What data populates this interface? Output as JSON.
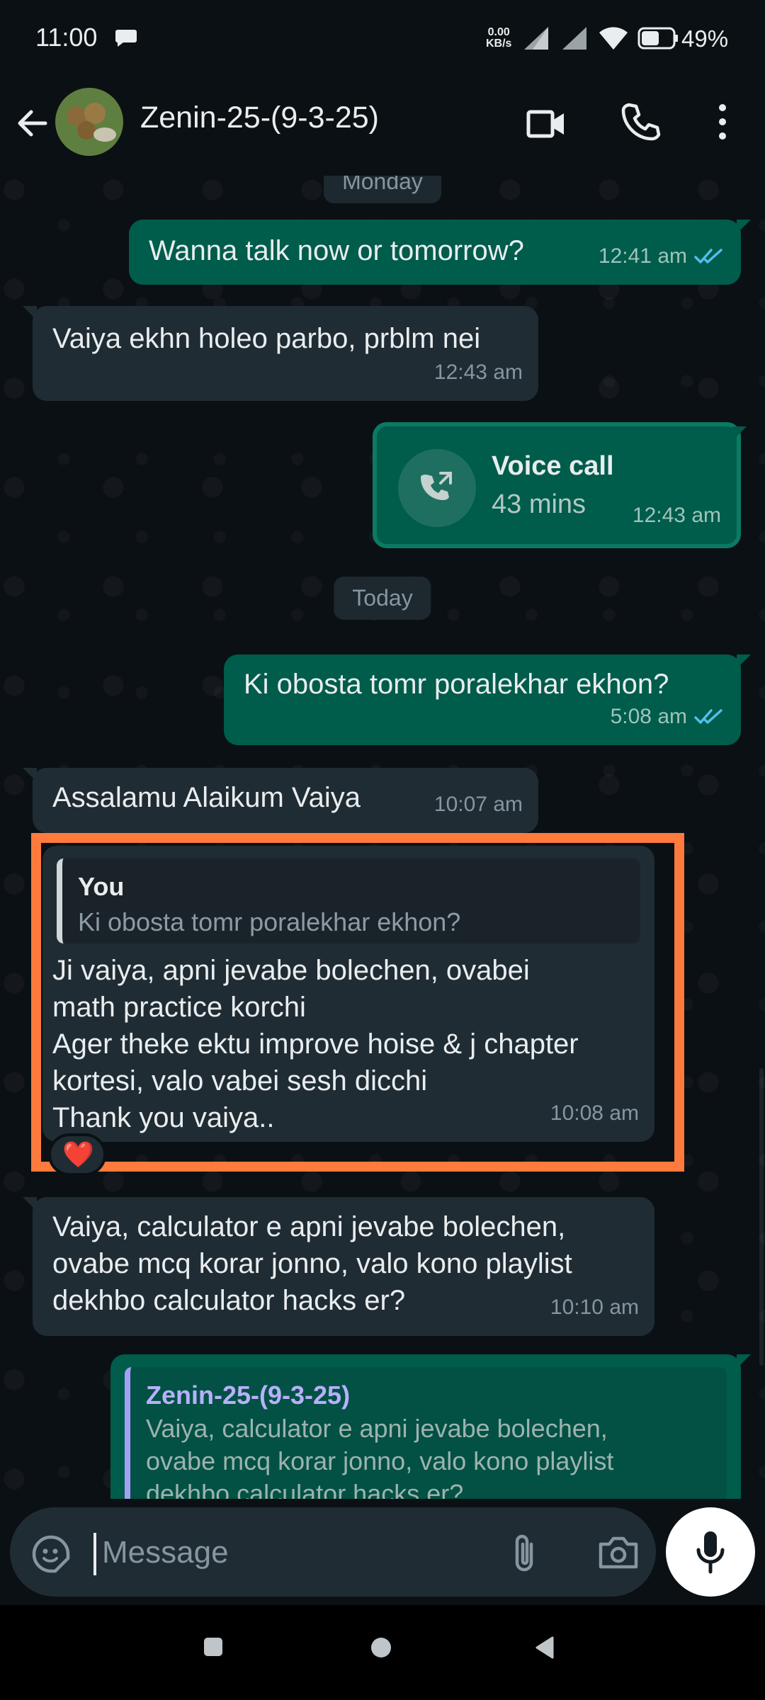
{
  "status_bar": {
    "time": "11:00",
    "net_speed_value": "0.00",
    "net_speed_unit": "KB/s",
    "battery": "49%"
  },
  "header": {
    "contact_name": "Zenin-25-(9-3-25)",
    "icons": [
      "back-arrow-icon",
      "video-call-icon",
      "phone-call-icon",
      "more-vert-icon"
    ]
  },
  "chat": {
    "day_chip_monday": "Monday",
    "day_chip_today": "Today",
    "messages": [
      {
        "direction": "out",
        "text": "Wanna talk now or tomorrow?",
        "time": "12:41 am",
        "read": true
      },
      {
        "direction": "in",
        "text": "Vaiya ekhn holeo parbo, prblm nei",
        "time": "12:43 am"
      },
      {
        "direction": "out",
        "type": "voice_call",
        "title": "Voice call",
        "duration": "43 mins",
        "time": "12:43 am"
      },
      {
        "direction": "out",
        "text": "Ki obosta tomr poralekhar ekhon?",
        "time": "5:08 am",
        "read": true
      },
      {
        "direction": "in",
        "text": "Assalamu Alaikum Vaiya",
        "time": "10:07 am"
      },
      {
        "direction": "in",
        "reply_to": {
          "author": "You",
          "text": "Ki obosta tomr poralekhar ekhon?"
        },
        "text": "Ji vaiya, apni jevabe bolechen, ovabei\nmath practice korchi\nAger theke ektu improve hoise & j chapter\nkortesi, valo vabei sesh dicchi\nThank you vaiya..",
        "time": "10:08 am",
        "reaction": "❤️"
      },
      {
        "direction": "in",
        "text": "Vaiya, calculator e apni jevabe bolechen,\novabe mcq korar jonno, valo kono playlist\ndekhbo calculator hacks er?",
        "time": "10:10 am"
      },
      {
        "direction": "out",
        "reply_to": {
          "author": "Zenin-25-(9-3-25)",
          "text": "Vaiya, calculator e apni jevabe bolechen,\novabe mcq korar jonno, valo kono playlist\ndekhbo calculator hacks er?"
        }
      }
    ]
  },
  "composer": {
    "placeholder": "Message",
    "icons": [
      "emoji-sticker-icon",
      "attach-icon",
      "camera-icon",
      "mic-icon"
    ]
  },
  "colors": {
    "background": "#0b1014",
    "incoming_bubble": "#202c33",
    "outgoing_bubble": "#005c4b",
    "read_ticks": "#53bdeb",
    "highlight": "#ff7a3d"
  }
}
